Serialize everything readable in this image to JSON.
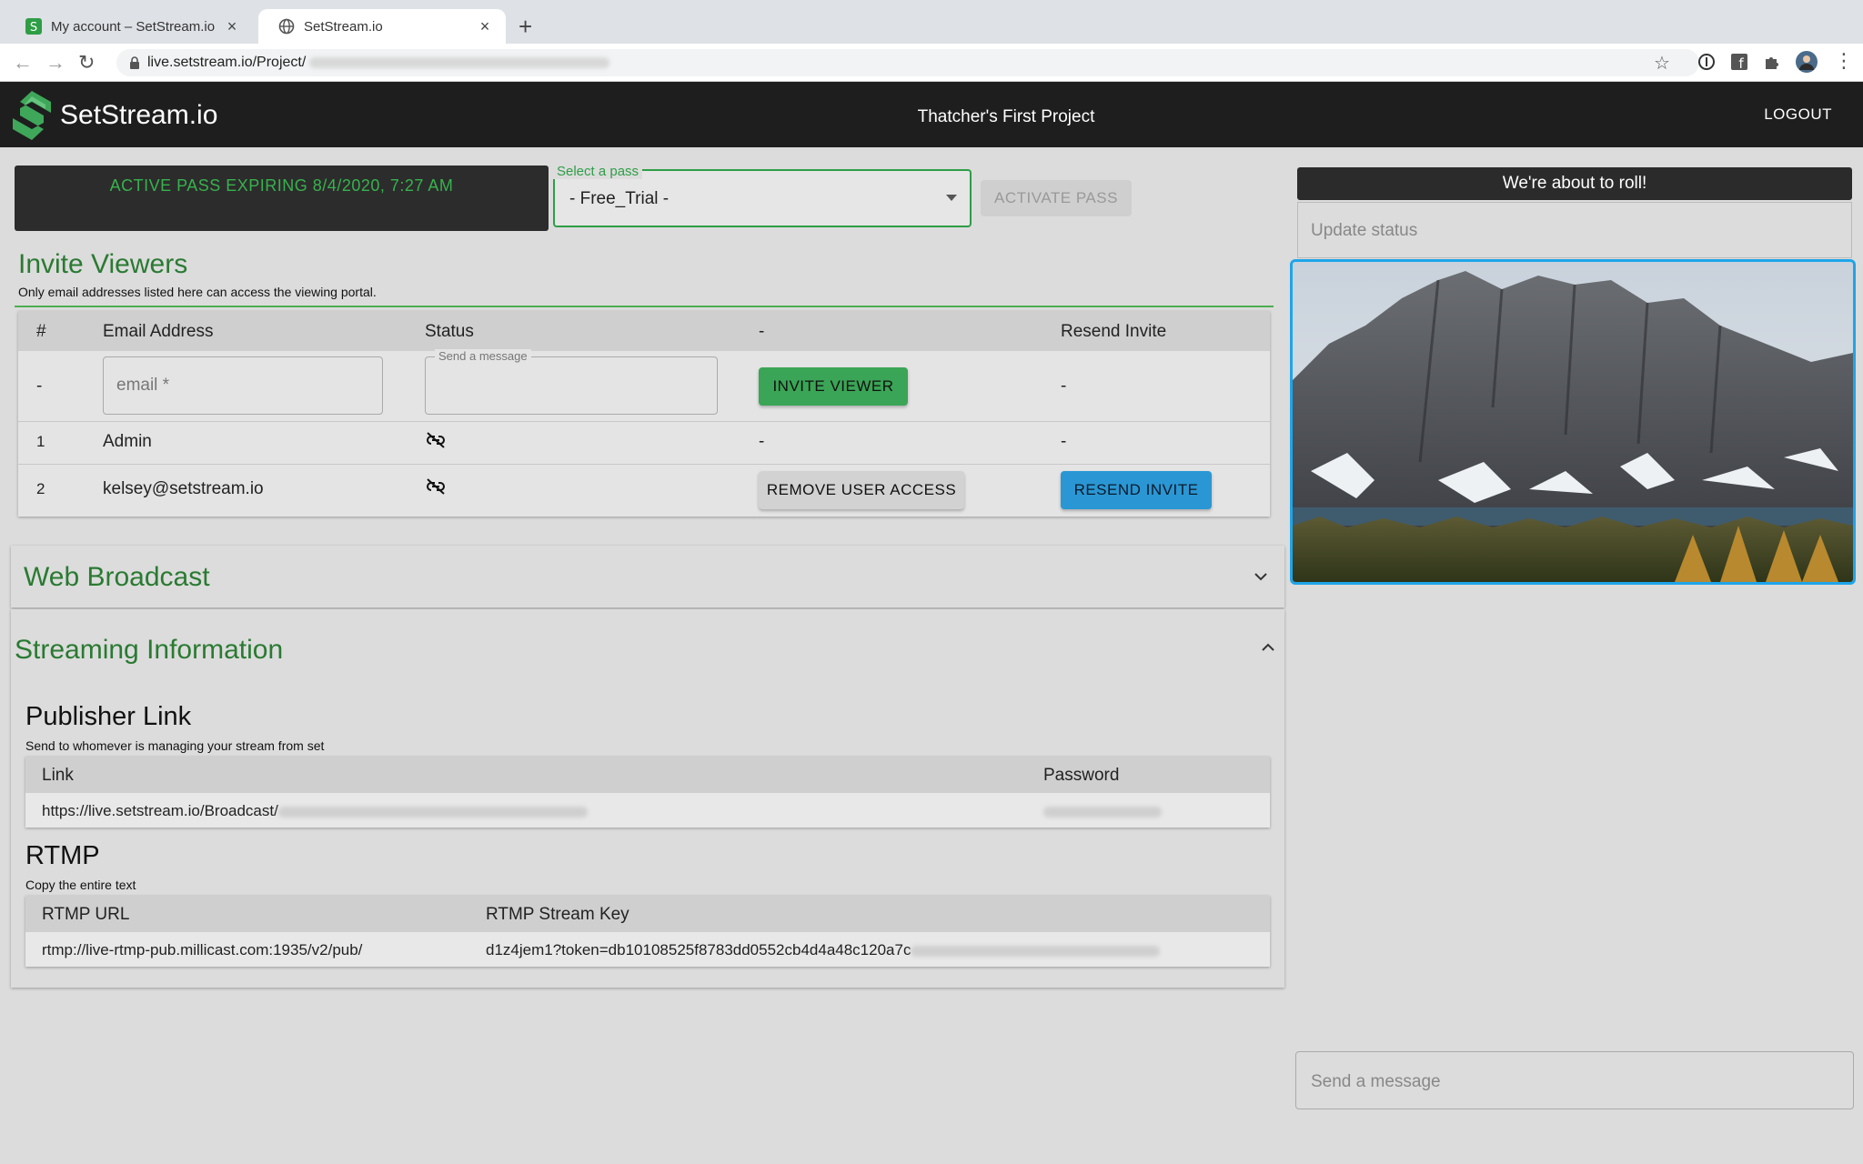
{
  "browser": {
    "tabs": [
      {
        "title": "My account – SetStream.io",
        "close": "×"
      },
      {
        "title": "SetStream.io",
        "close": "×"
      }
    ],
    "new_tab": "+",
    "url_prefix": "live.setstream.io/Project/"
  },
  "header": {
    "brand": "SetStream.io",
    "project_title": "Thatcher's First Project",
    "logout": "LOGOUT"
  },
  "pass": {
    "status_text": "ACTIVE PASS EXPIRING 8/4/2020, 7:27 AM",
    "select_label": "Select a pass",
    "select_value": "- Free_Trial -",
    "activate_button": "ACTIVATE PASS"
  },
  "invite": {
    "title": "Invite Viewers",
    "note": "Only email addresses listed here can access the viewing portal.",
    "columns": [
      "#",
      "Email Address",
      "Status",
      "-",
      "Resend Invite"
    ],
    "new_row": {
      "index": "-",
      "email_placeholder": "email *",
      "message_legend": "Send a message",
      "invite_button": "INVITE VIEWER",
      "resend": "-"
    },
    "rows": [
      {
        "index": "1",
        "email": "Admin",
        "action": "-",
        "resend": "-"
      },
      {
        "index": "2",
        "email": "kelsey@setstream.io",
        "action": "REMOVE USER ACCESS",
        "resend": "RESEND INVITE"
      }
    ]
  },
  "web_broadcast": {
    "title": "Web Broadcast"
  },
  "streaming": {
    "title": "Streaming Information",
    "publisher": {
      "title": "Publisher Link",
      "note": "Send to whomever is managing your stream from set",
      "columns": [
        "Link",
        "Password"
      ],
      "link_prefix": "https://live.setstream.io/Broadcast/"
    },
    "rtmp": {
      "title": "RTMP",
      "note": "Copy the entire text",
      "columns": [
        "RTMP URL",
        "RTMP Stream Key"
      ],
      "url": "rtmp://live-rtmp-pub.millicast.com:1935/v2/pub/",
      "key_prefix": "d1z4jem1?token=db10108525f8783dd0552cb4d4a48c120a7c"
    }
  },
  "side": {
    "status_banner": "We're about to roll!",
    "status_placeholder": "Update status",
    "message_placeholder": "Send a message"
  },
  "colors": {
    "accent_green": "#2a7a32",
    "pass_green": "#37b24d",
    "focus_blue": "#1ea5e9",
    "header_bg": "#1e1e1e"
  }
}
